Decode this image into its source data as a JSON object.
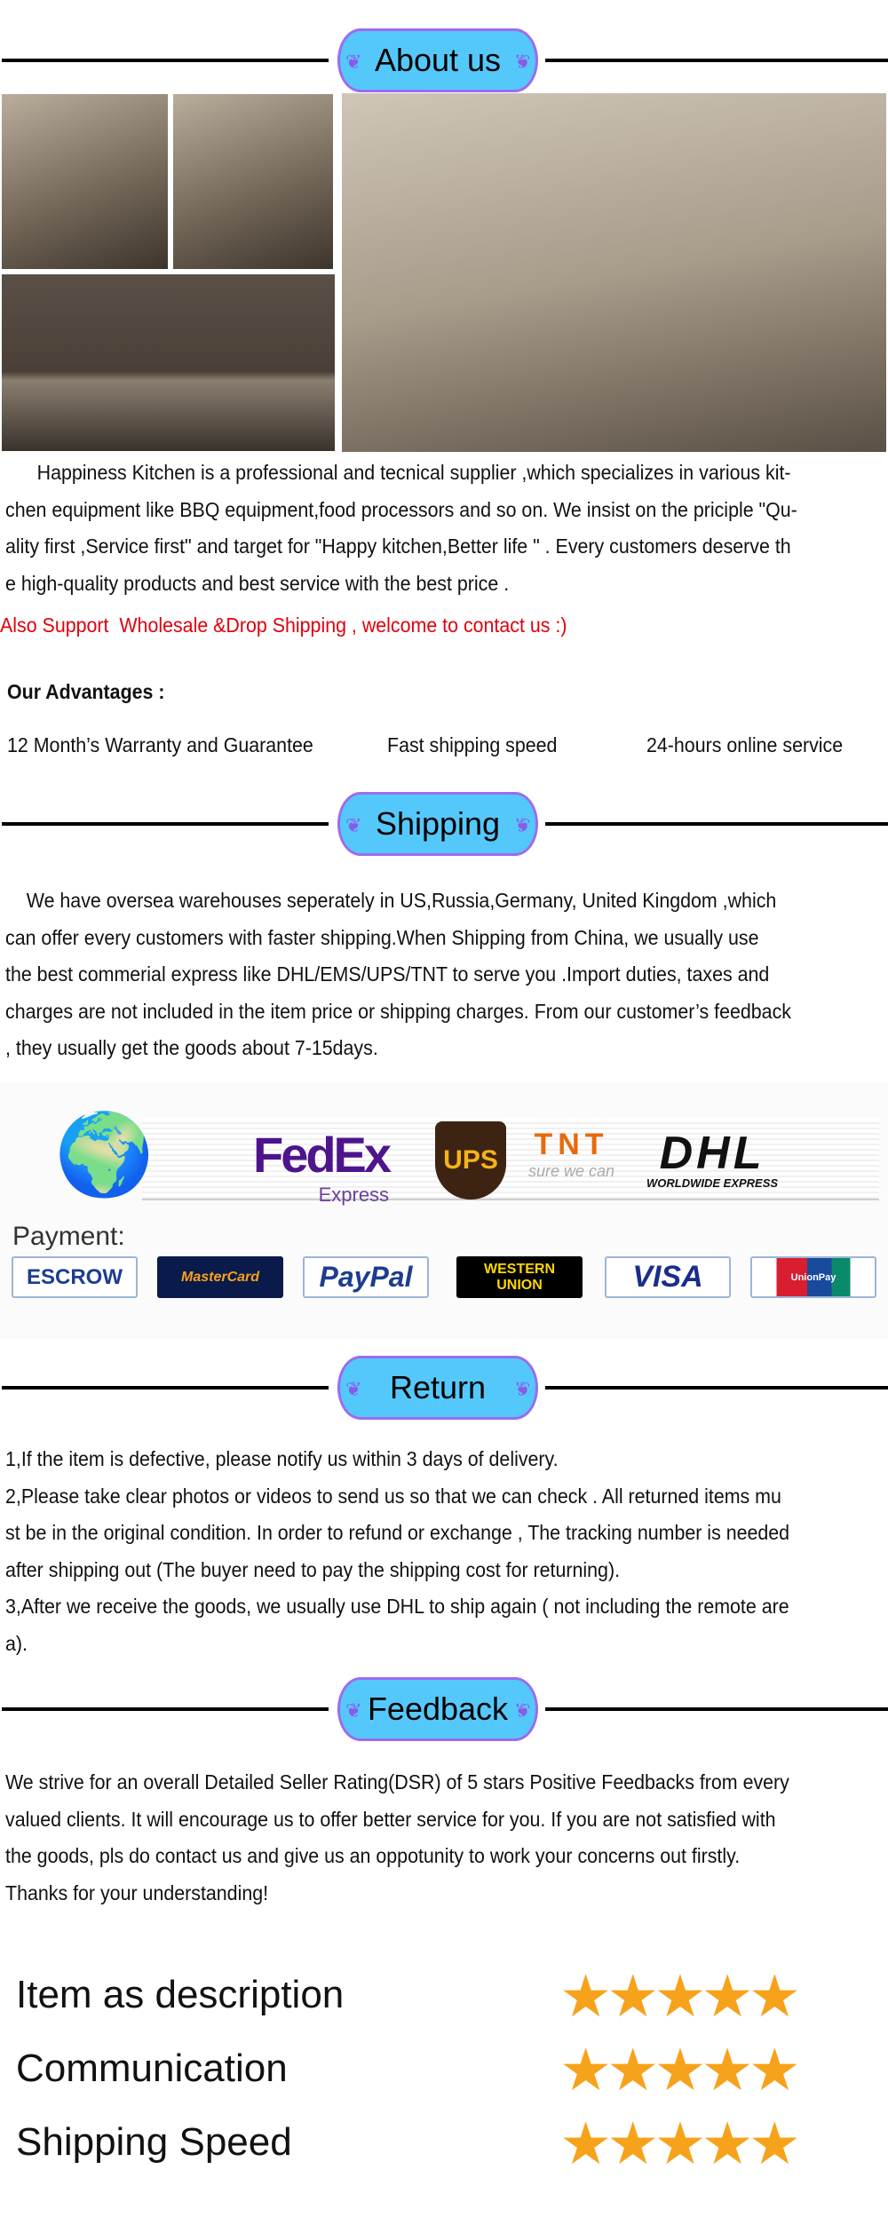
{
  "about": {
    "title": "About us",
    "paragraph": [
      "      Happiness Kitchen is a professional and tecnical supplier ,which specializes in various kit-",
      "chen equipment like BBQ equipment,food processors and so on. We insist on the priciple \"Qu-",
      "ality first ,Service first\" and target for \"Happy kitchen,Better life \" . Every customers deserve th",
      "e high-quality products and best service with the best price ."
    ],
    "promo": "Also Support  Wholesale &Drop Shipping , welcome to contact us :)",
    "advantages_title": "Our Advantages :",
    "advantages": [
      "12 Month’s Warranty and Guarantee",
      "Fast shipping speed",
      "24-hours online service"
    ]
  },
  "shipping": {
    "title": "Shipping",
    "paragraph": [
      "    We have oversea warehouses seperately in US,Russia,Germany, United Kingdom ,which",
      "can offer every customers with faster shipping.When Shipping from China, we usually use",
      "the best commerial express like DHL/EMS/UPS/TNT to serve you .Import duties, taxes and",
      "charges are not included in the item price or shipping charges. From our customer’s feedback",
      ", they usually get the goods about 7-15days."
    ],
    "carriers": {
      "fedex": "FedEx",
      "fedex_sub": "Express",
      "ups": "UPS",
      "tnt": "TNT",
      "tnt_sub": "sure we can",
      "dhl": "DHL",
      "dhl_sub": "WORLDWIDE EXPRESS"
    },
    "payment_label": "Payment:",
    "payments": [
      "ESCROW",
      "MasterCard",
      "PayPal",
      "WESTERN UNION",
      "VISA",
      "UnionPay"
    ]
  },
  "return": {
    "title": "Return",
    "lines": [
      "1,If the item is defective, please notify us within 3 days of delivery.",
      "2,Please take clear photos or videos to send us so that we can check . All returned items mu",
      "st be in the original condition. In order to refund or exchange , The tracking number is needed",
      "after shipping out (The buyer need to pay the shipping cost for returning).",
      "3,After we receive the goods, we usually use DHL to ship again ( not including the remote are",
      "a)."
    ]
  },
  "feedback": {
    "title": "Feedback",
    "lines": [
      "We strive for an overall Detailed Seller Rating(DSR) of 5 stars Positive Feedbacks from every",
      "valued clients. It will encourage us to offer better service for you. If you are not satisfied with",
      "the goods, pls do contact us and give us an oppotunity to work your concerns out firstly.",
      "Thanks for your understanding!"
    ]
  },
  "ratings": [
    {
      "label": "Item as description",
      "stars": 5
    },
    {
      "label": "Communication",
      "stars": 5
    },
    {
      "label": "Shipping Speed",
      "stars": 5
    }
  ],
  "colors": {
    "banner": "#55c8fb",
    "promo": "#e0000d",
    "stars": "#f7a21b"
  }
}
